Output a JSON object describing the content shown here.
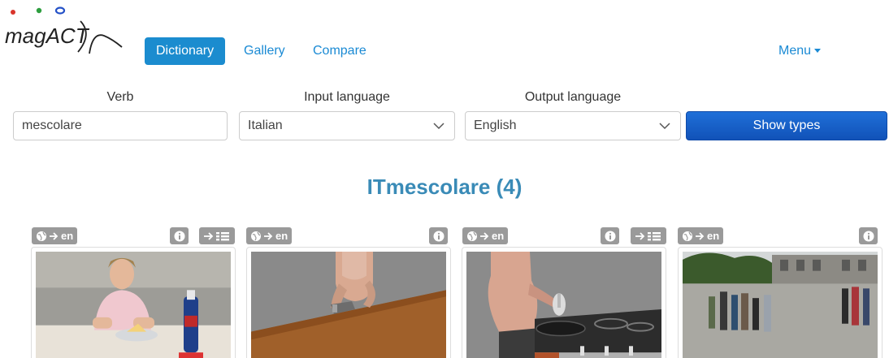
{
  "logo": {
    "text": "magACT"
  },
  "nav": {
    "dictionary": "Dictionary",
    "gallery": "Gallery",
    "compare": "Compare",
    "menu": "Menu"
  },
  "form": {
    "verb_label": "Verb",
    "verb_value": "mescolare",
    "input_language_label": "Input language",
    "input_language_value": "Italian",
    "output_language_label": "Output language",
    "output_language_value": "English",
    "show_types_label": "Show types"
  },
  "result": {
    "lang": "IT",
    "verb": "mescolare",
    "count": "(4)"
  },
  "cards": [
    {
      "translate_label": "en",
      "has_info": true,
      "has_grid": true
    },
    {
      "translate_label": "en",
      "has_info": true,
      "has_grid": false
    },
    {
      "translate_label": "en",
      "has_info": true,
      "has_grid": true
    },
    {
      "translate_label": "en",
      "has_info": true,
      "has_grid": false
    }
  ],
  "colors": {
    "accent": "#1b8ccf",
    "button": "#1661c9",
    "title": "#3a8bb7",
    "badge": "#9a9a9a"
  }
}
